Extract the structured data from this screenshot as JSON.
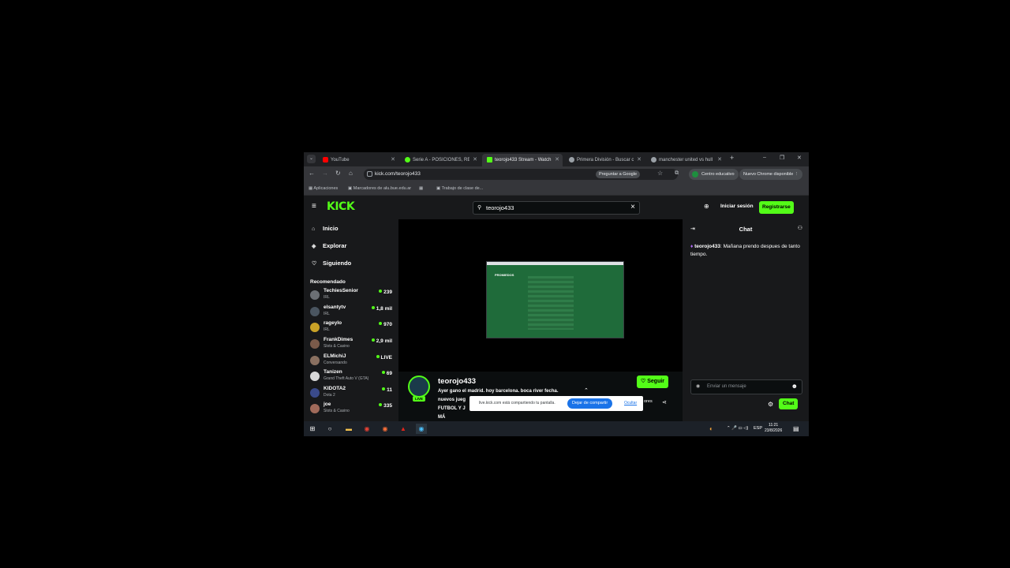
{
  "browser": {
    "tabs": [
      {
        "title": "YouTube",
        "color": "#ff0000"
      },
      {
        "title": "Serie A - POSICIONES, RESU",
        "color": "#53fc18"
      },
      {
        "title": "teorojo433 Stream - Watch",
        "color": "#53fc18",
        "active": true
      },
      {
        "title": "Primera División - Buscar co",
        "color": "#9aa0a6"
      },
      {
        "title": "manchester united vs hull ci",
        "color": "#9aa0a6"
      }
    ],
    "url": "kick.com/teorojo433",
    "ask_google": "Preguntar a Google",
    "profile": "Centro educativo",
    "update": "Nuevo Chrome disponible",
    "bookmarks": [
      "Aplicaciones",
      "Marcadores de alu.bue.edu.ar",
      "Trabajo de clase de..."
    ]
  },
  "header": {
    "logo": "KICK",
    "search_value": "teorojo433",
    "login": "Iniciar sesión",
    "signup": "Registrarse"
  },
  "sidebar": {
    "nav": [
      {
        "label": "Inicio",
        "icon": "home-icon"
      },
      {
        "label": "Explorar",
        "icon": "compass-icon"
      },
      {
        "label": "Siguiendo",
        "icon": "heart-icon"
      }
    ],
    "rec_title": "Recomendado",
    "recommended": [
      {
        "name": "TechiesSenior",
        "category": "IRL",
        "viewers": "239"
      },
      {
        "name": "elsantytv",
        "category": "IRL",
        "viewers": "1,8 mil"
      },
      {
        "name": "rageylo",
        "category": "IRL",
        "viewers": "970"
      },
      {
        "name": "FrankDimes",
        "category": "Slots & Casino",
        "viewers": "2,9 mil"
      },
      {
        "name": "ELMichiJ",
        "category": "Conversando",
        "viewers": "LIVE"
      },
      {
        "name": "Tanizen",
        "category": "Grand Theft Auto V (GTA)",
        "viewers": "69"
      },
      {
        "name": "KIDOTA2",
        "category": "Dota 2",
        "viewers": "11"
      },
      {
        "name": "joe",
        "category": "Slots & Casino",
        "viewers": "335"
      }
    ]
  },
  "stream": {
    "streamer": "teorojo433",
    "live_badge": "LIVE",
    "description_lines": [
      "Ayer gano el madrid. hoy barcelona. boca river fecha.",
      "nuevos jueg",
      "FUTBOL Y J",
      "MÁ"
    ],
    "follow": "Seguir",
    "shared_label": "PROMIEDOS",
    "ores_text": "ores"
  },
  "share_bar": {
    "text": "live.kick.com está compartiendo tu pantalla.",
    "stop": "Dejar de compartir",
    "hide": "Ocultar"
  },
  "chat": {
    "title": "Chat",
    "message_user": "teorojo433",
    "message_text": "Mañana prendo despues de tanto tiempo.",
    "input_placeholder": "Enviar un mensaje",
    "send": "Chat"
  },
  "taskbar": {
    "lang": "ESP",
    "time": "11:21",
    "date": "23/8/2026"
  }
}
